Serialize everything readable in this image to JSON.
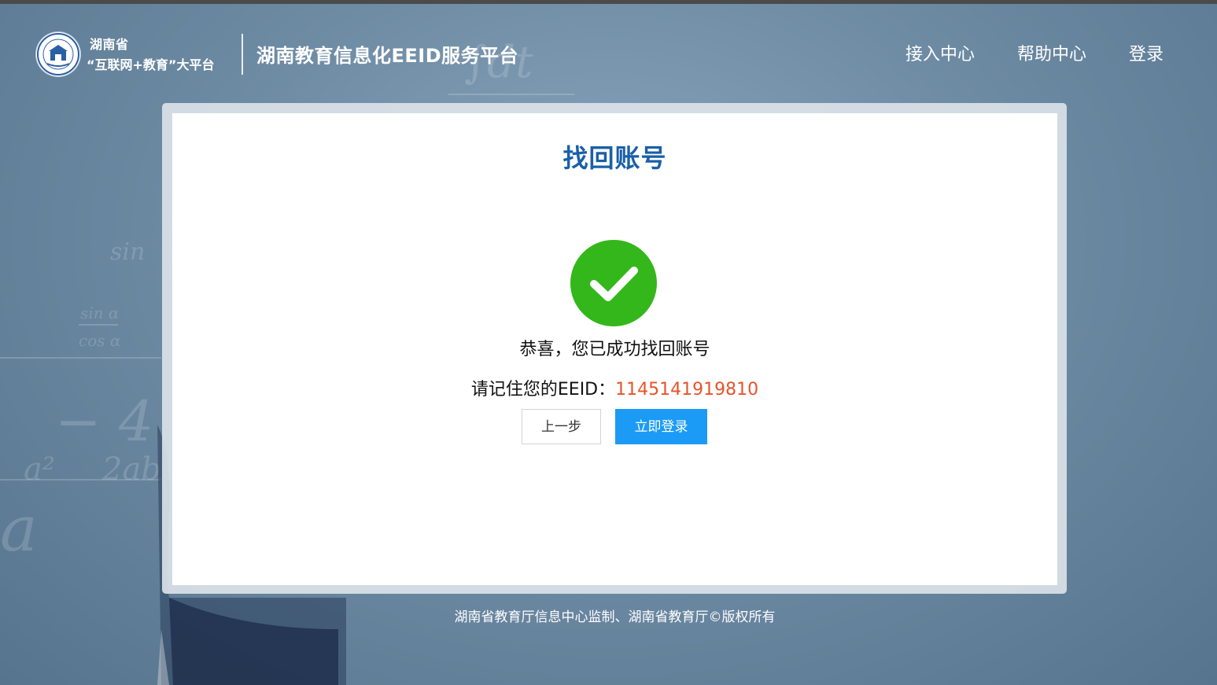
{
  "header": {
    "brand_line1": "湖南省",
    "brand_line2": "“互联网+教育”大平台",
    "site_title": "湖南教育信息化EEID服务平台",
    "nav": {
      "access_center": "接入中心",
      "help_center": "帮助中心",
      "login": "登录"
    }
  },
  "card": {
    "title": "找回账号",
    "success_icon": "check-circle-icon",
    "message": "恭喜，您已成功找回账号",
    "eeid_label": "请记住您的EEID：",
    "eeid_value": "1145141919810",
    "buttons": {
      "prev": "上一步",
      "login_now": "立即登录"
    }
  },
  "footer": {
    "copyright": "湖南省教育厅信息中心监制、湖南省教育厅©版权所有"
  },
  "colors": {
    "title_blue": "#1a5fa8",
    "success_green": "#34b71a",
    "eeid_orange": "#e8532a",
    "primary_button": "#1b9bf5"
  }
}
